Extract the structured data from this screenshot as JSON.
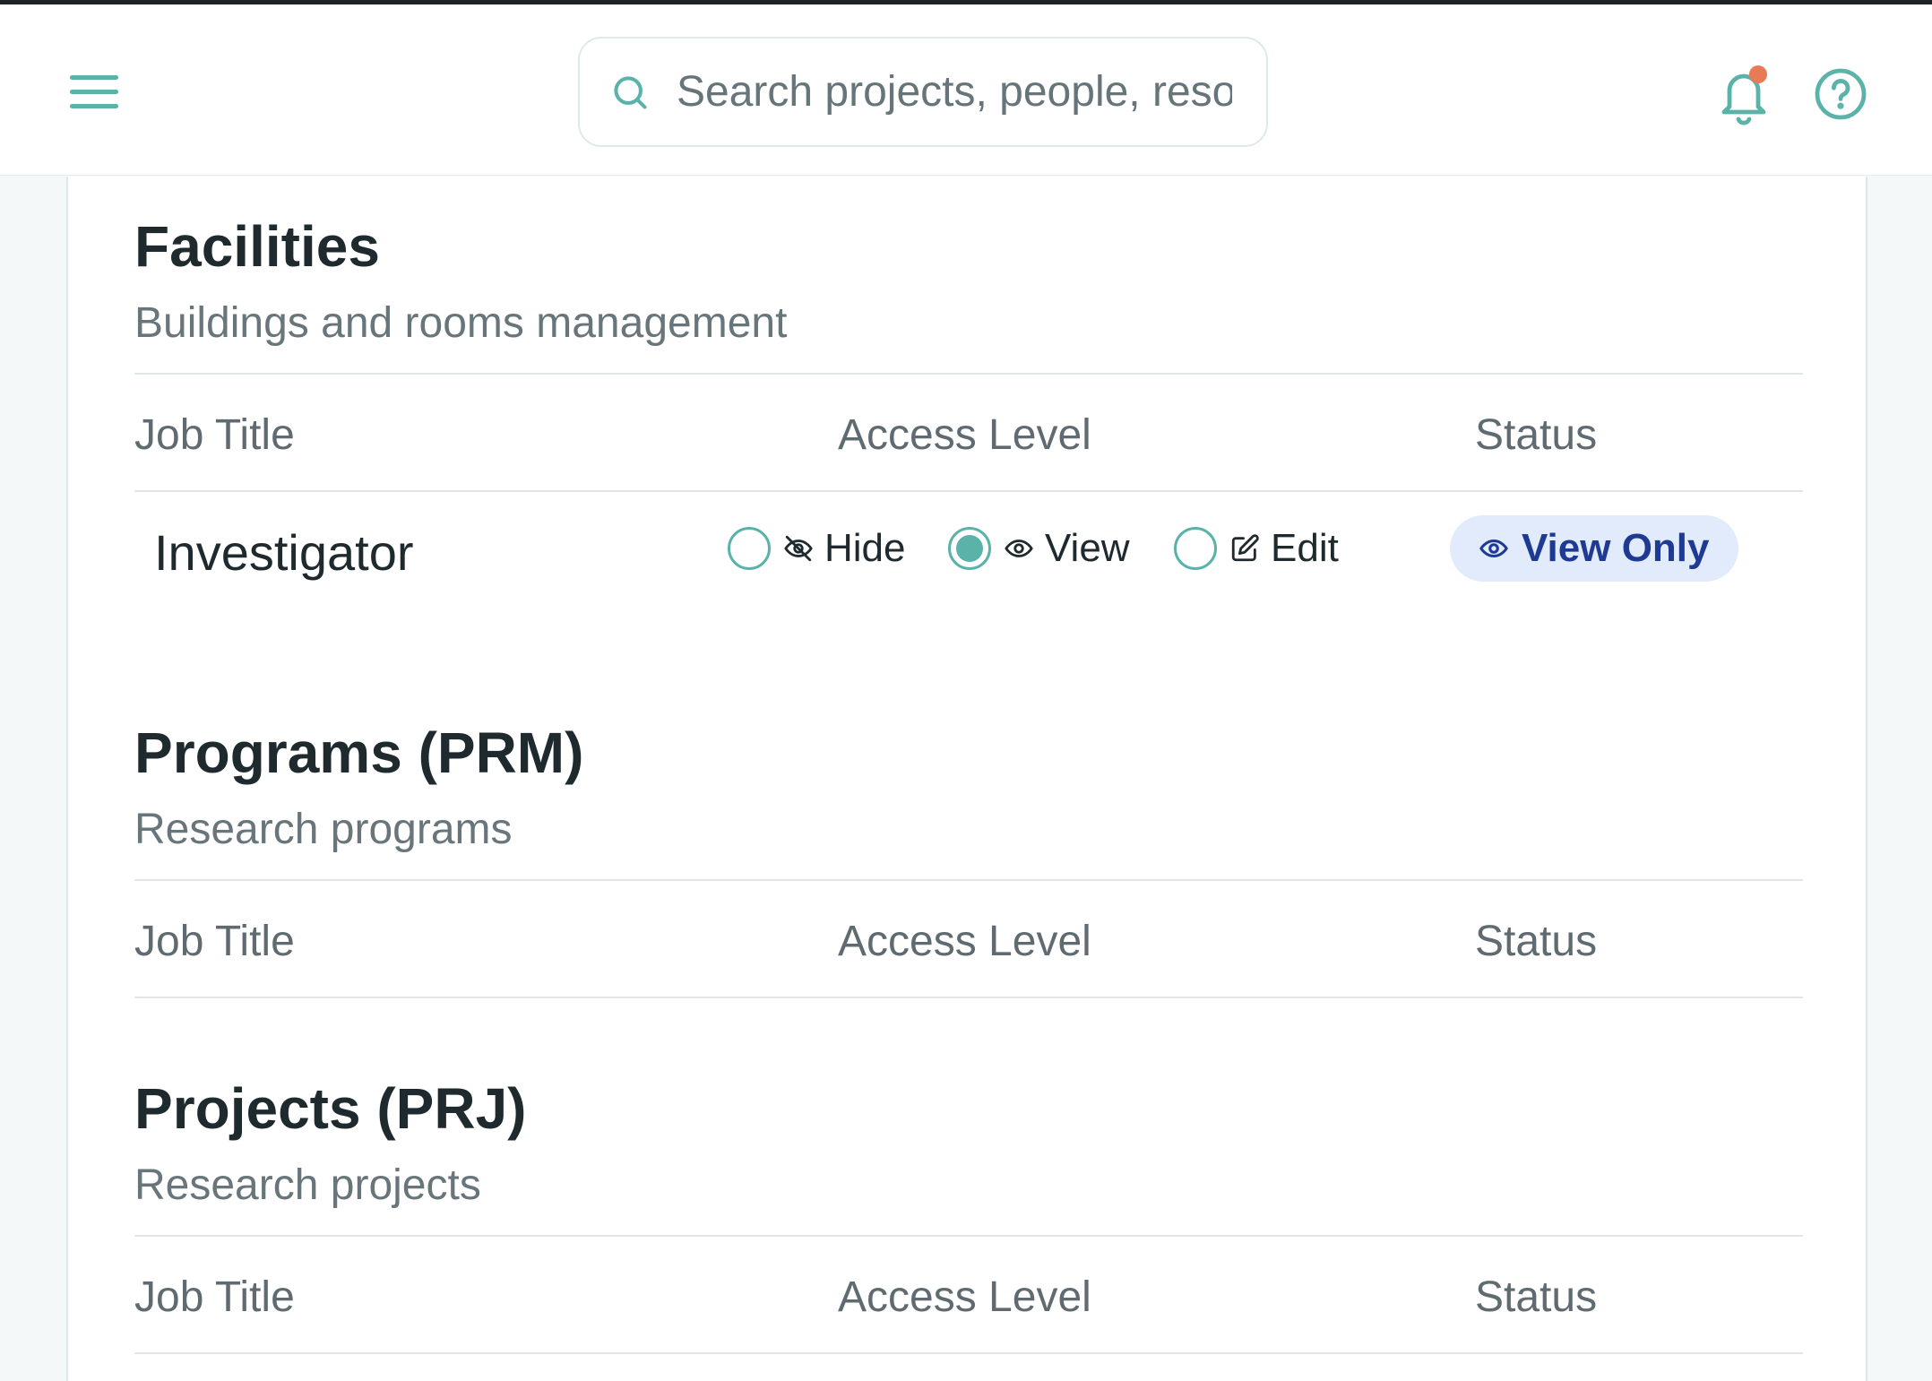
{
  "header": {
    "search_placeholder": "Search projects, people, resources..."
  },
  "colors": {
    "accent": "#5ab2a9",
    "notification_dot": "#e87a55",
    "badge_bg": "#e1ebfb",
    "badge_text": "#1e3a93"
  },
  "columns": {
    "job_title": "Job Title",
    "access_level": "Access Level",
    "status": "Status"
  },
  "sections": [
    {
      "title": "Facilities",
      "subtitle": "Buildings and rooms management",
      "rows": [
        {
          "job_title": "Investigator",
          "options": [
            "Hide",
            "View",
            "Edit"
          ],
          "selected": "View",
          "status": "View Only"
        }
      ]
    },
    {
      "title": "Programs (PRM)",
      "subtitle": "Research programs",
      "rows": []
    },
    {
      "title": "Projects (PRJ)",
      "subtitle": "Research projects",
      "rows": []
    }
  ]
}
